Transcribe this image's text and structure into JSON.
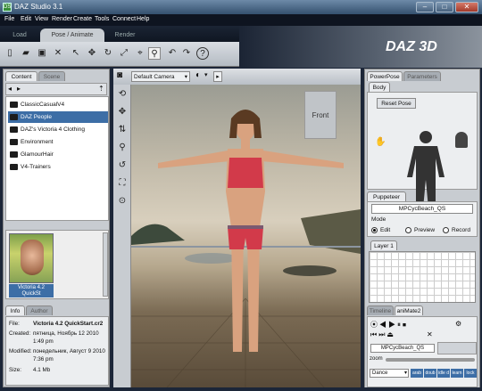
{
  "window": {
    "title": "DAZ Studio 3.1",
    "logo": "DS",
    "min": "–",
    "max": "□",
    "close": "✕"
  },
  "menu": [
    "File",
    "Edit",
    "View",
    "Render",
    "Create",
    "Tools",
    "Connect",
    "Help"
  ],
  "main_tabs": [
    "Load",
    "Pose / Animate",
    "Render"
  ],
  "brand": "DAZ 3D",
  "left_panel": {
    "tabs": [
      "Content",
      "Scene"
    ],
    "folders": [
      "ClassicCasualV4",
      "DAZ People",
      "DAZ's Victoria 4 Clothing",
      "Environment",
      "GlamourHair",
      "V4-Trainers"
    ],
    "selected_folder": "DAZ People",
    "thumb_label": "Victoria 4.2 QuickSt",
    "info_tabs": [
      "Info",
      "Author"
    ],
    "info": [
      {
        "k": "File:",
        "v": "Victoria 4.2 QuickStart.cr2"
      },
      {
        "k": "Created:",
        "v": "пятница, Ноябрь 12 2010 1:49 pm"
      },
      {
        "k": "Modified:",
        "v": "понедельник, Август 9 2010 7:36 pm"
      },
      {
        "k": "Size:",
        "v": "4.1 Mb"
      }
    ]
  },
  "viewport": {
    "camera": "Default Camera",
    "front_label": "Front"
  },
  "right_panel": {
    "tabs": [
      "PowerPose",
      "Parameters"
    ],
    "body_tab": "Body",
    "reset_pose": "Reset Pose",
    "puppeteer_tab": "Puppeteer",
    "puppeteer_file": "MPCycBeach_QS",
    "mode_label": "Mode",
    "modes": [
      "Edit",
      "Preview",
      "Record"
    ],
    "layer_label": "Layer 1",
    "anim_tabs": [
      "Timeline",
      "aniMate2"
    ],
    "anim_file": "MPCycBeach_QS",
    "zoom_label": "zoom",
    "dance_label": "Dance",
    "anim_buttons": [
      "arab",
      "doub",
      "idle d",
      "learn",
      "lock"
    ]
  }
}
